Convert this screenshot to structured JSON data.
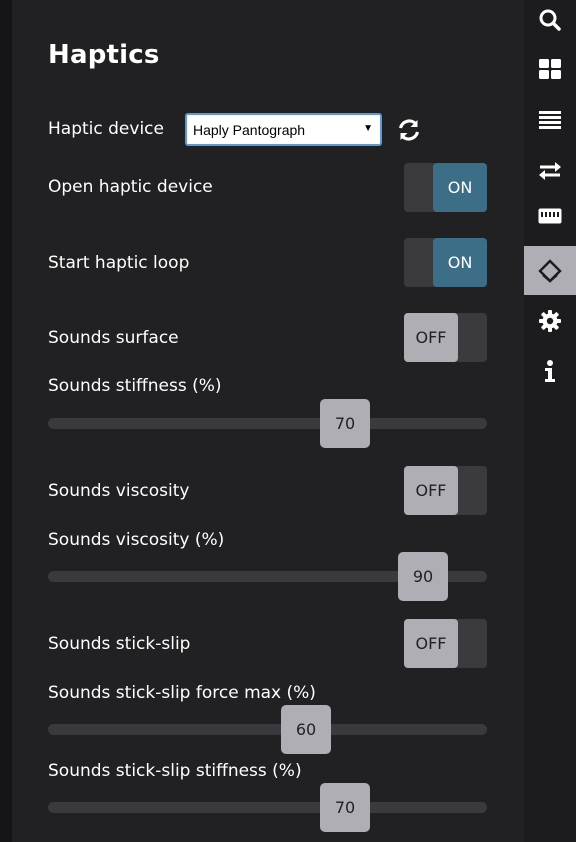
{
  "panel": {
    "title": "Haptics",
    "device_label": "Haptic device",
    "device_select": {
      "value": "Haply Pantograph",
      "caret": "▼"
    },
    "rows": {
      "open_device": {
        "label": "Open haptic device",
        "state": "ON"
      },
      "start_loop": {
        "label": "Start haptic loop",
        "state": "ON"
      },
      "sounds_surface": {
        "label": "Sounds surface",
        "state": "OFF"
      },
      "sounds_stiffness": {
        "label": "Sounds stiffness (%)",
        "value": "70"
      },
      "sounds_viscosity": {
        "label": "Sounds viscosity",
        "state": "OFF"
      },
      "sounds_viscosity_pct": {
        "label": "Sounds viscosity (%)",
        "value": "90"
      },
      "sounds_stick_slip": {
        "label": "Sounds stick-slip",
        "state": "OFF"
      },
      "stick_slip_force": {
        "label": "Sounds stick-slip force max (%)",
        "value": "60"
      },
      "stick_slip_stiffness": {
        "label": "Sounds stick-slip stiffness (%)",
        "value": "70"
      }
    }
  },
  "sidebar": {
    "icons": [
      "search-icon",
      "grid-icon",
      "list-icon",
      "transfer-arrows-icon",
      "keyboard-icon",
      "haptics-icon",
      "gear-icon",
      "info-icon"
    ],
    "active": "haptics-icon"
  },
  "colors": {
    "background": "#212123",
    "toggle_on": "#3d6e88",
    "toggle_off": "#b0aeb5",
    "track": "#3a3a3e"
  }
}
